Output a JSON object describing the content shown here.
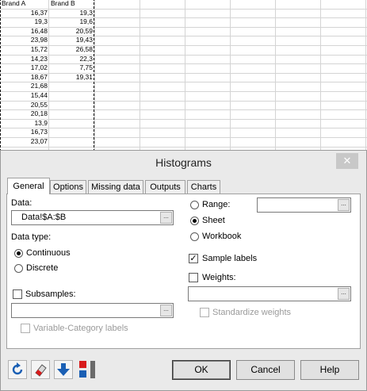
{
  "sheet": {
    "headers": [
      "Brand A",
      "Brand B"
    ],
    "brand_a": [
      "16,37",
      "19,3",
      "16,48",
      "23,98",
      "15,72",
      "14,23",
      "17,02",
      "18,67",
      "21,68",
      "15,44",
      "20,55",
      "20,18",
      "13,9",
      "16,73",
      "23,07"
    ],
    "brand_b": [
      "19,3",
      "19,6",
      "20,59",
      "19,43",
      "26,58",
      "22,3",
      "7,75",
      "19,31"
    ]
  },
  "dialog": {
    "title": "Histograms",
    "close_glyph": "✕",
    "tabs": [
      "General",
      "Options",
      "Missing data",
      "Outputs",
      "Charts"
    ],
    "active_tab": "General",
    "data_label": "Data:",
    "data_value": "Data!$A:$B",
    "pick_glyph": "...",
    "data_type_label": "Data type:",
    "continuous_label": "Continuous",
    "discrete_label": "Discrete",
    "data_type_selected": "Continuous",
    "subsamples_label": "Subsamples:",
    "subsamples_checked": false,
    "subsamples_value": "",
    "var_category_label": "Variable-Category labels",
    "range_label": "Range:",
    "sheet_label": "Sheet",
    "workbook_label": "Workbook",
    "output_selected": "Sheet",
    "range_value": "",
    "sample_labels_label": "Sample labels",
    "sample_labels_checked": true,
    "weights_label": "Weights:",
    "weights_checked": false,
    "weights_value": "",
    "standardize_label": "Standardize weights",
    "check_glyph": "✓",
    "ok_label": "OK",
    "cancel_label": "Cancel",
    "help_label": "Help",
    "colors": {
      "tool_icon_blue": "#1a5fb4",
      "tool_icon_red": "#d81b1b",
      "tool_icon_gray": "#6b6b6b"
    }
  }
}
